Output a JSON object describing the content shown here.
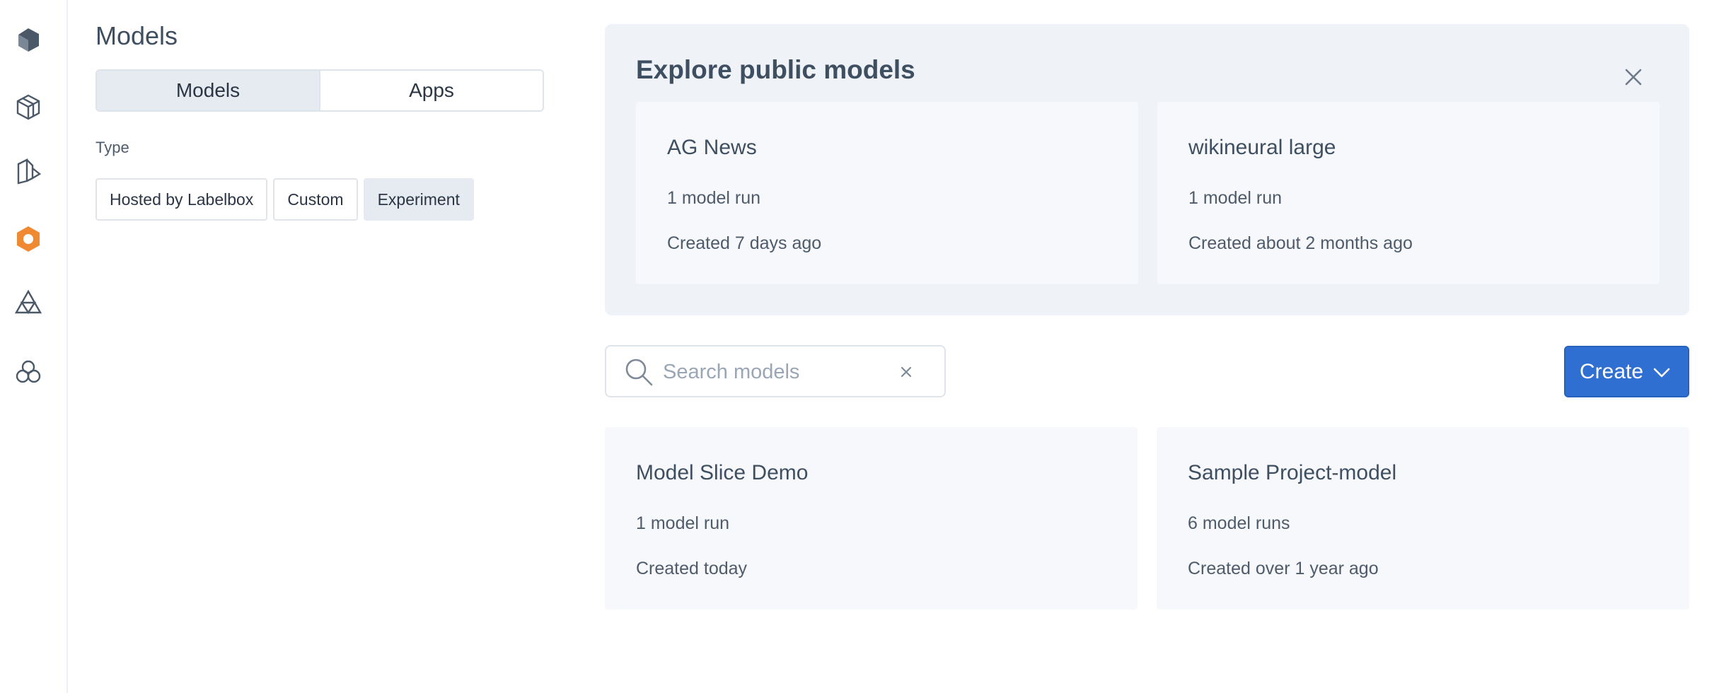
{
  "sidebar": {
    "icons": [
      "labelbox-logo-icon",
      "catalog-icon",
      "annotate-icon",
      "models-icon",
      "workflow-icon",
      "integrations-icon"
    ],
    "active_index": 3,
    "accent": "#ef8a32"
  },
  "filters": {
    "title": "Models",
    "tabs": [
      {
        "label": "Models",
        "active": true
      },
      {
        "label": "Apps",
        "active": false
      }
    ],
    "type_label": "Type",
    "type_chips": [
      {
        "label": "Hosted by Labelbox",
        "active": false
      },
      {
        "label": "Custom",
        "active": false
      },
      {
        "label": "Experiment",
        "active": true
      }
    ]
  },
  "explore": {
    "title": "Explore public models",
    "cards": [
      {
        "title": "AG News",
        "runs": "1 model run",
        "created": "Created 7 days ago"
      },
      {
        "title": "wikineural large",
        "runs": "1 model run",
        "created": "Created about 2 months ago"
      }
    ]
  },
  "search": {
    "placeholder": "Search models",
    "value": ""
  },
  "create_button": {
    "label": "Create",
    "color": "#2f6fd1"
  },
  "models": [
    {
      "title": "Model Slice Demo",
      "runs": "1 model run",
      "created": "Created today"
    },
    {
      "title": "Sample Project-model",
      "runs": "6 model runs",
      "created": "Created over 1 year ago"
    }
  ]
}
